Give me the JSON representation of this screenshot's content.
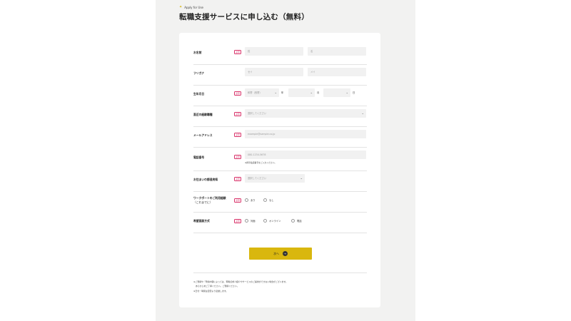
{
  "header": {
    "eyebrow": "Apply for Use",
    "title": "転職支援サービスに申し込む（無料）"
  },
  "required_badge": "必須",
  "form": {
    "name": {
      "label": "お名前",
      "last_placeholder": "姓",
      "first_placeholder": "名"
    },
    "kana": {
      "label": "フリガナ",
      "last_placeholder": "セイ",
      "first_placeholder": "メイ"
    },
    "birthdate": {
      "label": "生年月日",
      "year_value": "和暦（西暦）",
      "year_unit": "年",
      "month_unit": "月",
      "day_unit": "日"
    },
    "occupation": {
      "label": "直近の経験職種",
      "value": "選択してください"
    },
    "email": {
      "label": "メールアドレス",
      "placeholder": "example@sample.co.jp"
    },
    "phone": {
      "label": "電話番号",
      "placeholder": "080-1234-5678",
      "hint": "※携帯電話番号をご入力ください。"
    },
    "prefecture": {
      "label": "お住まいの都道府県",
      "value": "選択してください"
    },
    "work_support": {
      "label_line1": "ワークポートのご利用経験",
      "label_line2": "（これまでに）",
      "options": [
        "あり",
        "なし"
      ]
    },
    "interview": {
      "label": "希望面談方式",
      "options": [
        "対面",
        "オンライン",
        "電話"
      ]
    }
  },
  "next_button": {
    "label": "次へ",
    "icon": "arrow-right-icon"
  },
  "notes": [
    "※ご登録や「申請内容によっては、現時点求人紹介やサービスのご提供ができない場合がございます。",
    "　あらかじめご了承ください。ご登録ください。",
    "※日付・時間は目安より変動します。"
  ],
  "colors": {
    "accent": "#d9b70e",
    "required": "#d9336a",
    "background": "#f2f2f1",
    "card": "#ffffff"
  }
}
